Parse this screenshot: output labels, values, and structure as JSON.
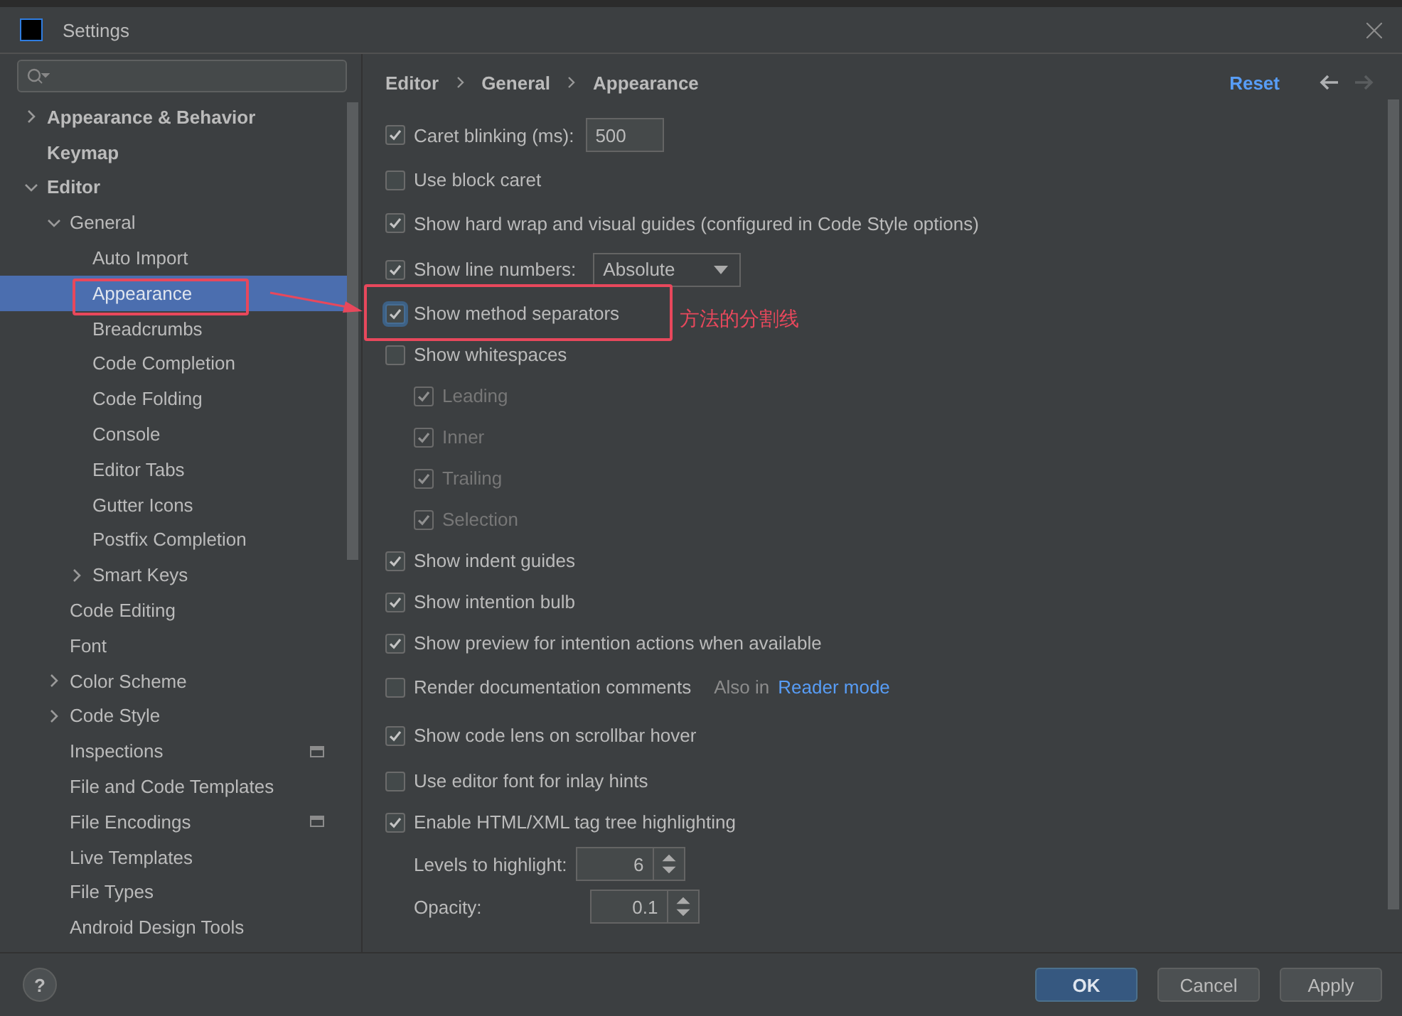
{
  "window": {
    "title": "Settings"
  },
  "help": {
    "label": "?"
  },
  "sidebar": {
    "items": [
      {
        "label": "Appearance & Behavior",
        "expanded": false,
        "selected": false
      },
      {
        "label": "Keymap",
        "selected": false
      },
      {
        "label": "Editor",
        "expanded": true,
        "selected": false,
        "children": [
          {
            "label": "General",
            "expanded": true,
            "selected": false,
            "children": [
              {
                "label": "Auto Import",
                "selected": false
              },
              {
                "label": "Appearance",
                "selected": true
              },
              {
                "label": "Breadcrumbs",
                "selected": false
              },
              {
                "label": "Code Completion",
                "selected": false
              },
              {
                "label": "Code Folding",
                "selected": false
              },
              {
                "label": "Console",
                "selected": false
              },
              {
                "label": "Editor Tabs",
                "selected": false
              },
              {
                "label": "Gutter Icons",
                "selected": false
              },
              {
                "label": "Postfix Completion",
                "selected": false
              },
              {
                "label": "Smart Keys",
                "expanded": false,
                "selected": false
              }
            ]
          },
          {
            "label": "Code Editing",
            "selected": false
          },
          {
            "label": "Font",
            "selected": false
          },
          {
            "label": "Color Scheme",
            "expanded": false,
            "selected": false
          },
          {
            "label": "Code Style",
            "expanded": false,
            "selected": false
          },
          {
            "label": "Inspections",
            "scope_icon": true,
            "selected": false
          },
          {
            "label": "File and Code Templates",
            "selected": false
          },
          {
            "label": "File Encodings",
            "scope_icon": true,
            "selected": false
          },
          {
            "label": "Live Templates",
            "selected": false
          },
          {
            "label": "File Types",
            "selected": false
          },
          {
            "label": "Android Design Tools",
            "selected": false
          }
        ]
      }
    ]
  },
  "breadcrumb": [
    "Editor",
    "General",
    "Appearance"
  ],
  "header": {
    "reset": "Reset",
    "back_enabled": true,
    "forward_enabled": false
  },
  "settings": [
    {
      "kind": "input",
      "label": "Caret blinking (ms):",
      "checked": true,
      "value": "500"
    },
    {
      "kind": "checkbox",
      "label": "Use block caret",
      "checked": false
    },
    {
      "kind": "checkbox",
      "label": "Show hard wrap and visual guides (configured in Code Style options)",
      "checked": true
    },
    {
      "kind": "select",
      "label": "Show line numbers:",
      "checked": true,
      "value": "Absolute"
    },
    {
      "kind": "checkbox",
      "label": "Show method separators",
      "checked": true,
      "focused": true
    },
    {
      "kind": "checkbox",
      "label": "Show whitespaces",
      "checked": false,
      "children": [
        {
          "label": "Leading",
          "checked": true,
          "disabled": true
        },
        {
          "label": "Inner",
          "checked": true,
          "disabled": true
        },
        {
          "label": "Trailing",
          "checked": true,
          "disabled": true
        },
        {
          "label": "Selection",
          "checked": true,
          "disabled": true
        }
      ]
    },
    {
      "kind": "checkbox",
      "label": "Show indent guides",
      "checked": true
    },
    {
      "kind": "checkbox",
      "label": "Show intention bulb",
      "checked": true
    },
    {
      "kind": "checkbox",
      "label": "Show preview for intention actions when available",
      "checked": true
    },
    {
      "kind": "link",
      "label": "Render documentation comments",
      "checked": false,
      "note": "Also in",
      "link": "Reader mode"
    },
    {
      "kind": "checkbox",
      "label": "Show code lens on scrollbar hover",
      "checked": true
    },
    {
      "kind": "checkbox",
      "label": "Use editor font for inlay hints",
      "checked": false
    },
    {
      "kind": "checkbox",
      "label": "Enable HTML/XML tag tree highlighting",
      "checked": true
    },
    {
      "kind": "spinner",
      "label": "Levels to highlight:",
      "value": "6"
    },
    {
      "kind": "spinner",
      "label": "Opacity:",
      "value": "0.1"
    }
  ],
  "annotation": {
    "text": "方法的分割线"
  },
  "buttons": [
    {
      "label": "OK",
      "primary": true
    },
    {
      "label": "Cancel",
      "primary": false
    },
    {
      "label": "Apply",
      "primary": false
    }
  ]
}
